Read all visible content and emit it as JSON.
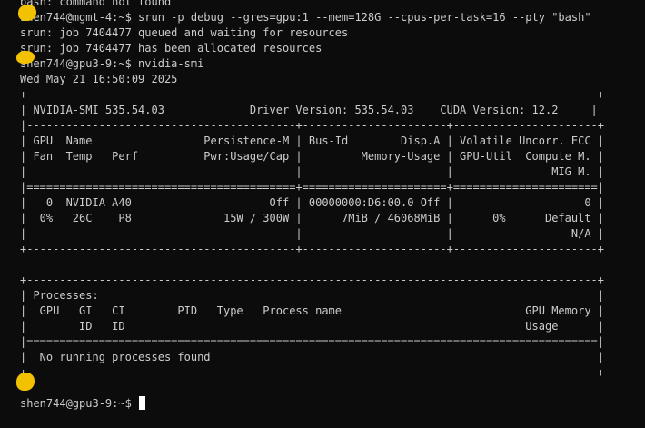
{
  "theme": {
    "background": "#0c0c0c",
    "text": "#cccccc",
    "cursor": "#ffffff",
    "redaction_marker": "#f2c200"
  },
  "terminal": {
    "lines": [
      "bash: command not found",
      "shen744@mgmt-4:~$ srun -p debug --gres=gpu:1 --mem=128G --cpus-per-task=16 --pty \"bash\"",
      "srun: job 7404477 queued and waiting for resources",
      "srun: job 7404477 has been allocated resources",
      "shen744@gpu3-9:~$ nvidia-smi",
      "Wed May 21 16:50:09 2025",
      "+---------------------------------------------------------------------------------------+",
      "| NVIDIA-SMI 535.54.03             Driver Version: 535.54.03    CUDA Version: 12.2     |",
      "|-----------------------------------------+----------------------+----------------------+",
      "| GPU  Name                 Persistence-M | Bus-Id        Disp.A | Volatile Uncorr. ECC |",
      "| Fan  Temp   Perf          Pwr:Usage/Cap |         Memory-Usage | GPU-Util  Compute M. |",
      "|                                         |                      |               MIG M. |",
      "|=========================================+======================+======================|",
      "|   0  NVIDIA A40                     Off | 00000000:D6:00.0 Off |                    0 |",
      "|  0%   26C    P8              15W / 300W |      7MiB / 46068MiB |      0%      Default |",
      "|                                         |                      |                  N/A |",
      "+-----------------------------------------+----------------------+----------------------+",
      "",
      "+---------------------------------------------------------------------------------------+",
      "| Processes:                                                                            |",
      "|  GPU   GI   CI        PID   Type   Process name                            GPU Memory |",
      "|        ID   ID                                                             Usage      |",
      "|=======================================================================================|",
      "|  No running processes found                                                           |",
      "+---------------------------------------------------------------------------------------+"
    ],
    "prompt": "shen744@gpu3-9:~$ "
  }
}
